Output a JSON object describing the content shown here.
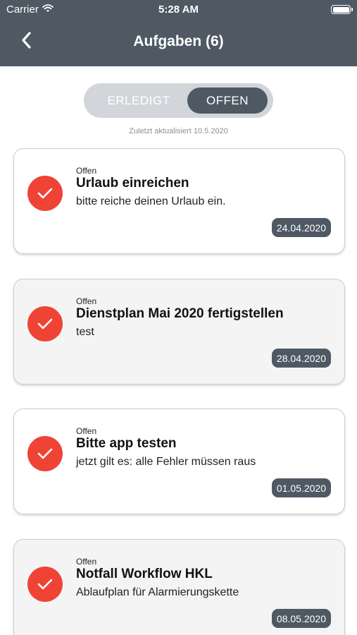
{
  "status_bar": {
    "carrier": "Carrier",
    "time": "5:28 AM"
  },
  "nav": {
    "title": "Aufgaben (6)"
  },
  "segments": {
    "done": "ERLEDIGT",
    "open": "OFFEN",
    "selected": "OFFEN"
  },
  "last_updated": "Zuletzt aktualisiert 10.5.2020",
  "colors": {
    "header": "#4e5964",
    "accent_red": "#ef4336",
    "segment_bg": "#d2d5d9"
  },
  "tasks": [
    {
      "status": "Offen",
      "title": "Urlaub einreichen",
      "description": "bitte reiche deinen Urlaub ein.",
      "date": "24.04.2020"
    },
    {
      "status": "Offen",
      "title": "Dienstplan Mai 2020 fertigstellen",
      "description": "test",
      "date": "28.04.2020"
    },
    {
      "status": "Offen",
      "title": "Bitte app testen",
      "description": "jetzt gilt es: alle Fehler müssen raus",
      "date": "01.05.2020"
    },
    {
      "status": "Offen",
      "title": "Notfall Workflow HKL",
      "description": "Ablaufplan für Alarmierungskette",
      "date": "08.05.2020"
    }
  ]
}
